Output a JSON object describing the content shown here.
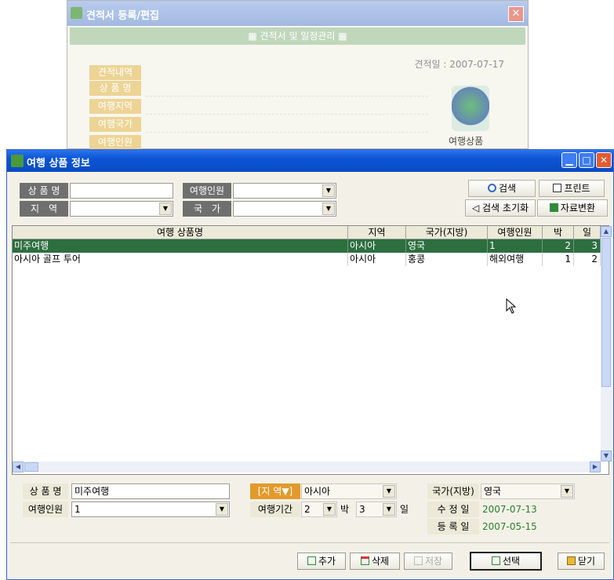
{
  "bg_window": {
    "title": "견적서 등록/편집",
    "band": "▦ 견적서 및 일정관리 ▦",
    "date_label": "견적일 : 2007-07-17",
    "tab": "견적내역",
    "fields": [
      "상 품 명",
      "여행지역",
      "여행국가",
      "여행인원"
    ],
    "photo_label": "여행상품"
  },
  "window": {
    "title": "여행 상품 정보"
  },
  "search": {
    "product_label": "상 품 명",
    "product_value": "",
    "people_label": "여행인원",
    "people_value": "",
    "region_label": "지　역",
    "region_value": "",
    "country_label": "국　가",
    "country_value": "",
    "search_btn": "검색",
    "print_btn": "프린트",
    "reset_btn": "◁ 검색 초기화",
    "convert_btn": "자료변환"
  },
  "grid": {
    "headers": [
      "여행 상품명",
      "지역",
      "국가(지방)",
      "여행인원",
      "박",
      "일"
    ],
    "rows": [
      {
        "name": "미주여행",
        "region": "아시아",
        "country": "영국",
        "people": "1",
        "nights": "2",
        "days": "3"
      },
      {
        "name": "아시아 골프 투어",
        "region": "아시아",
        "country": "홍콩",
        "people": "해외여행",
        "nights": "1",
        "days": "2"
      }
    ]
  },
  "detail": {
    "product_label": "상 품 명",
    "product_value": "미주여행",
    "people_label": "여행인원",
    "people_value": "1",
    "region_label": "[지 역▼]",
    "region_value": "아시아",
    "period_label": "여행기간",
    "nights_value": "2",
    "nights_unit": "박",
    "days_value": "3",
    "days_unit": "일",
    "country_label": "국가(지방)",
    "country_value": "영국",
    "modified_label": "수 정 일",
    "modified_value": "2007-07-13",
    "registered_label": "등 록 일",
    "registered_value": "2007-05-15"
  },
  "buttons": {
    "add": "추가",
    "delete": "삭제",
    "save": "저장",
    "select": "선택",
    "close": "닫기"
  }
}
